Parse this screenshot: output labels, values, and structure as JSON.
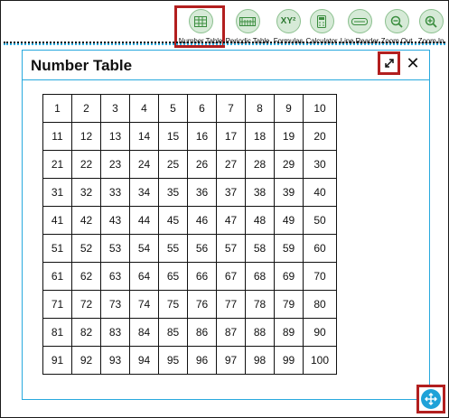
{
  "toolbar": {
    "items": [
      {
        "label": "Number Table",
        "icon": "number-table-icon"
      },
      {
        "label": "Periodic Table",
        "icon": "periodic-table-icon"
      },
      {
        "label": "Formulas",
        "icon": "formulas-icon",
        "glyph": "XY²"
      },
      {
        "label": "Calculator",
        "icon": "calculator-icon"
      },
      {
        "label": "Line Reader",
        "icon": "line-reader-icon"
      },
      {
        "label": "Zoom Out",
        "icon": "zoom-out-icon"
      },
      {
        "label": "Zoom In",
        "icon": "zoom-in-icon"
      }
    ]
  },
  "dialog": {
    "title": "Number Table",
    "close_glyph": "✕"
  },
  "number_table": {
    "rows": [
      [
        "1",
        "2",
        "3",
        "4",
        "5",
        "6",
        "7",
        "8",
        "9",
        "10"
      ],
      [
        "11",
        "12",
        "13",
        "14",
        "15",
        "16",
        "17",
        "18",
        "19",
        "20"
      ],
      [
        "21",
        "22",
        "23",
        "24",
        "25",
        "26",
        "27",
        "28",
        "29",
        "30"
      ],
      [
        "31",
        "32",
        "33",
        "34",
        "35",
        "36",
        "37",
        "38",
        "39",
        "40"
      ],
      [
        "41",
        "42",
        "43",
        "44",
        "45",
        "46",
        "47",
        "48",
        "49",
        "50"
      ],
      [
        "51",
        "52",
        "53",
        "54",
        "55",
        "56",
        "57",
        "58",
        "59",
        "60"
      ],
      [
        "61",
        "62",
        "63",
        "64",
        "65",
        "66",
        "67",
        "68",
        "69",
        "70"
      ],
      [
        "71",
        "72",
        "73",
        "74",
        "75",
        "76",
        "77",
        "78",
        "79",
        "80"
      ],
      [
        "81",
        "82",
        "83",
        "84",
        "85",
        "86",
        "87",
        "88",
        "89",
        "90"
      ],
      [
        "91",
        "92",
        "93",
        "94",
        "95",
        "96",
        "97",
        "98",
        "99",
        "100"
      ]
    ]
  },
  "colors": {
    "accent": "#28a9de",
    "highlight": "#b21f1f",
    "tool_circle": "#d6ead7",
    "move_handle": "#1fa2d8"
  }
}
